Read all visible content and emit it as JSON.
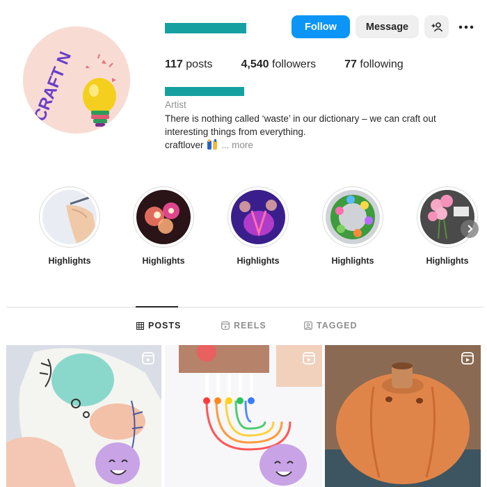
{
  "profile": {
    "follow_label": "Follow",
    "message_label": "Message",
    "avatar_text": "CRAFT N",
    "stats": {
      "posts_count": "117",
      "posts_label": "posts",
      "followers_count": "4,540",
      "followers_label": "followers",
      "following_count": "77",
      "following_label": "following"
    },
    "category": "Artist",
    "bio_line1": "There is nothing called ‘waste’ in our dictionary – we can craft out",
    "bio_line2": "interesting things from everything.",
    "bio_line3": "craftlover",
    "more_prefix": "...",
    "more_label": "more"
  },
  "highlights": [
    {
      "label": "Highlights"
    },
    {
      "label": "Highlights"
    },
    {
      "label": "Highlights"
    },
    {
      "label": "Highlights"
    },
    {
      "label": "Highlights"
    }
  ],
  "tabs": [
    {
      "label": "POSTS",
      "icon": "grid-icon",
      "active": true
    },
    {
      "label": "REELS",
      "icon": "reels-icon",
      "active": false
    },
    {
      "label": "TAGGED",
      "icon": "tagged-icon",
      "active": false
    }
  ],
  "colors": {
    "accent": "#0a95f7",
    "redacted_bar": "#16a0a0"
  }
}
